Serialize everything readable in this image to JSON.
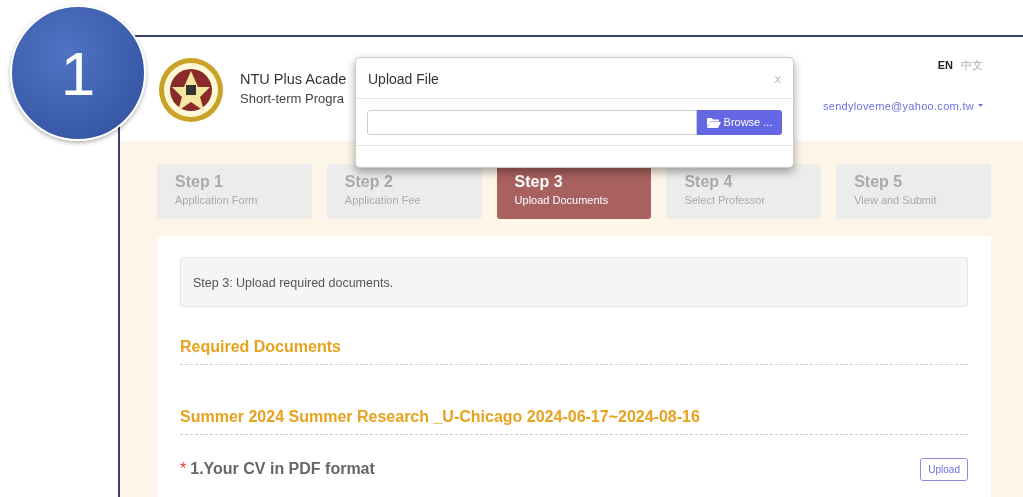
{
  "step_badge": {
    "number": "1"
  },
  "header": {
    "title": "NTU Plus Acade",
    "subtitle": "Short-term Progra",
    "languages": [
      {
        "label": "EN",
        "selected": true
      },
      {
        "label": "中文",
        "selected": false
      }
    ],
    "user_menu": {
      "email": "sendyloveme@yahoo.com.tw"
    }
  },
  "modal": {
    "title": "Upload File",
    "close": "x",
    "browse_button": "Browse ..."
  },
  "steps": [
    {
      "title": "Step 1",
      "subtitle": "Application Form",
      "selected": false
    },
    {
      "title": "Step 2",
      "subtitle": "Application Fee",
      "selected": false
    },
    {
      "title": "Step 3",
      "subtitle": "Upload Documents",
      "selected": true
    },
    {
      "title": "Step 4",
      "subtitle": "Select Professor",
      "selected": false
    },
    {
      "title": "Step 5",
      "subtitle": "View and Submit",
      "selected": false
    }
  ],
  "instruction": "Step 3: Upload required documents.",
  "section_title": "Required Documents",
  "programs": [
    {
      "title": "Summer 2024 Summer Research _U-Chicago 2024-06-17~2024-08-16",
      "documents": [
        {
          "required_mark": "*",
          "label": "1.Your CV in PDF format",
          "action": "Upload"
        }
      ]
    }
  ]
}
